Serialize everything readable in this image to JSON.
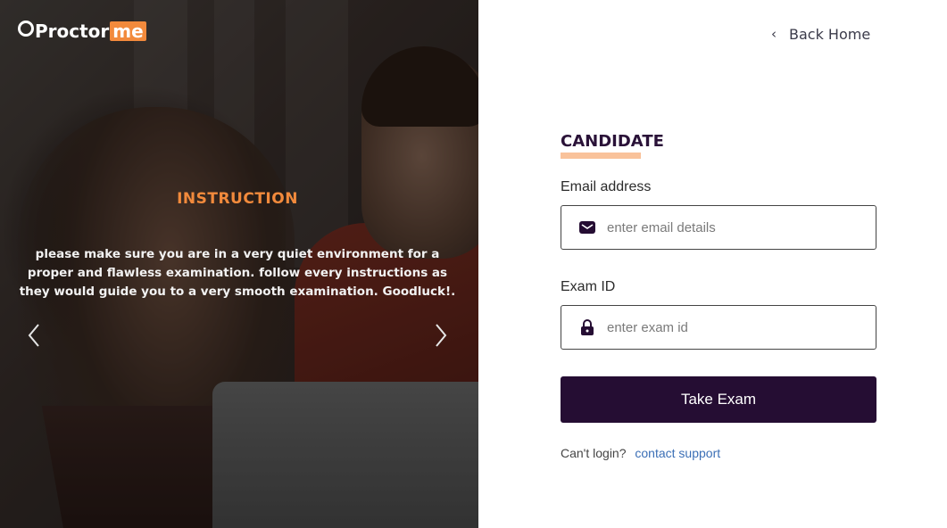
{
  "brand": {
    "logo_text_main": "Proctor",
    "logo_text_accent": "me"
  },
  "hero": {
    "title": "INSTRUCTION",
    "text": "please make sure you are in a very quiet environment for a proper and flawless examination. follow every instructions as they would guide you to a very smooth examination. Goodluck!.",
    "prev_icon": "chevron-left-icon",
    "next_icon": "chevron-right-icon"
  },
  "nav": {
    "back_home_label": "Back Home",
    "back_icon": "chevron-left-icon"
  },
  "form": {
    "title": "CANDIDATE",
    "email": {
      "label": "Email address",
      "placeholder": "enter email details",
      "value": "",
      "icon": "envelope-icon"
    },
    "exam_id": {
      "label": "Exam ID",
      "placeholder": "enter exam id",
      "value": "",
      "icon": "lock-icon"
    },
    "submit_label": "Take Exam",
    "support_prompt": "Can't login?",
    "support_link": "contact support"
  },
  "colors": {
    "accent": "#f28a3c",
    "primary": "#250d33",
    "underline": "#f9c29a",
    "link": "#3b6fb6"
  }
}
